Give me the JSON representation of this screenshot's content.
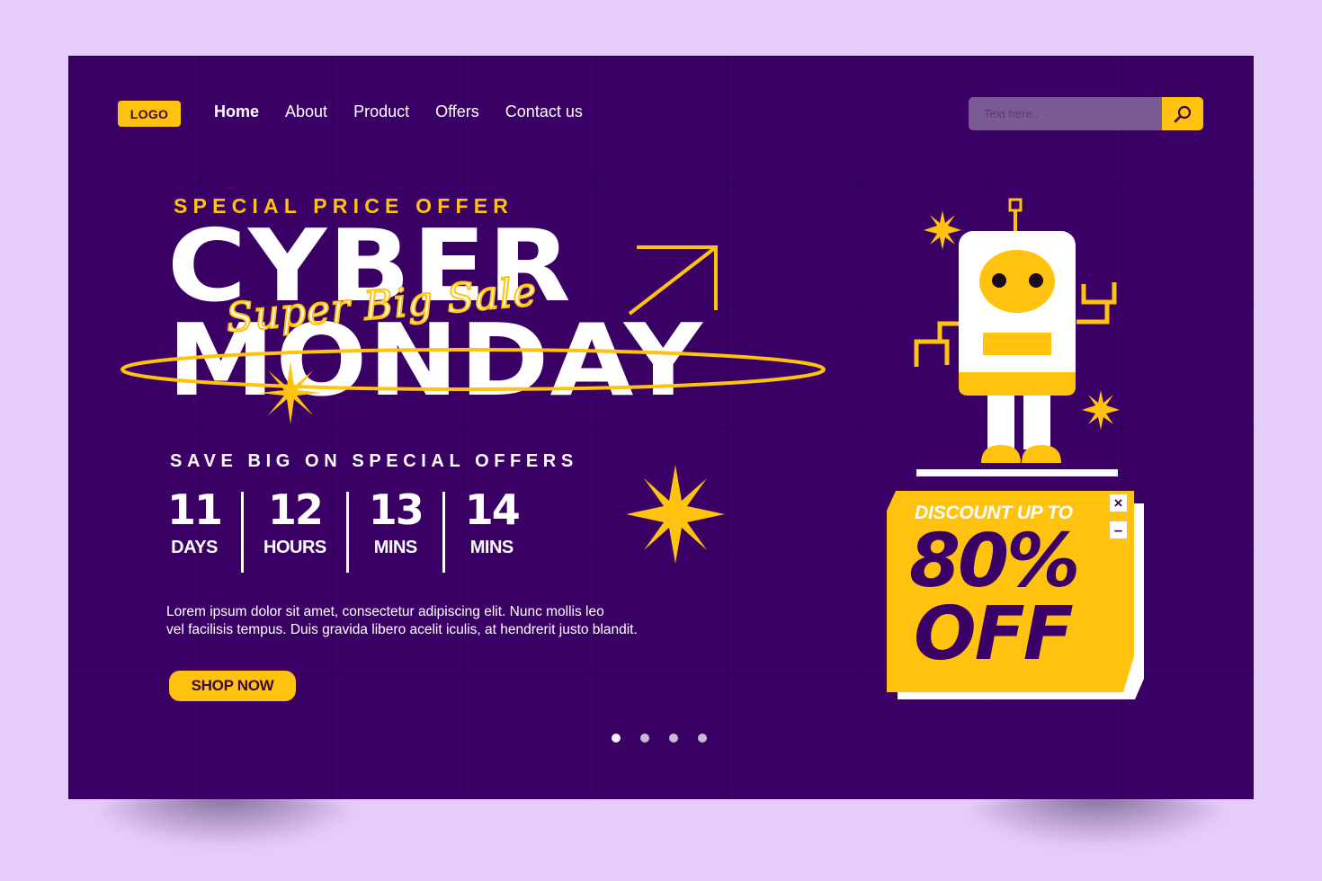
{
  "header": {
    "logo": "LOGO",
    "nav": [
      {
        "label": "Home",
        "active": true
      },
      {
        "label": "About",
        "active": false
      },
      {
        "label": "Product",
        "active": false
      },
      {
        "label": "Offers",
        "active": false
      },
      {
        "label": "Contact us",
        "active": false
      }
    ],
    "search": {
      "placeholder": "Text here..",
      "value": "",
      "icon": "search-icon"
    }
  },
  "hero": {
    "eyebrow": "SPECIAL PRICE OFFER",
    "title_line1": "CYBER",
    "title_line2": "MONDAY",
    "script_text": "Super Big Sale",
    "subheading": "SAVE BIG ON SPECIAL OFFERS",
    "countdown": [
      {
        "value": "11",
        "unit": "DAYS"
      },
      {
        "value": "12",
        "unit": "HOURS"
      },
      {
        "value": "13",
        "unit": "MINS"
      },
      {
        "value": "14",
        "unit": "MINS"
      }
    ],
    "body_line1": "Lorem ipsum dolor sit amet, consectetur adipiscing elit. Nunc mollis leo",
    "body_line2": "vel facilisis tempus. Duis gravida libero acelit iculis, at hendrerit justo blandit.",
    "cta": "SHOP NOW"
  },
  "carousel": {
    "count": 4,
    "active_index": 0
  },
  "promo": {
    "label": "DISCOUNT UP TO",
    "percent": "80%",
    "off": "OFF",
    "close_icon": "×",
    "minimize_icon": "–"
  },
  "colors": {
    "background": "#e6ccfb",
    "panel": "#3b0065",
    "accent": "#ffc20e",
    "text": "#ffffff"
  }
}
